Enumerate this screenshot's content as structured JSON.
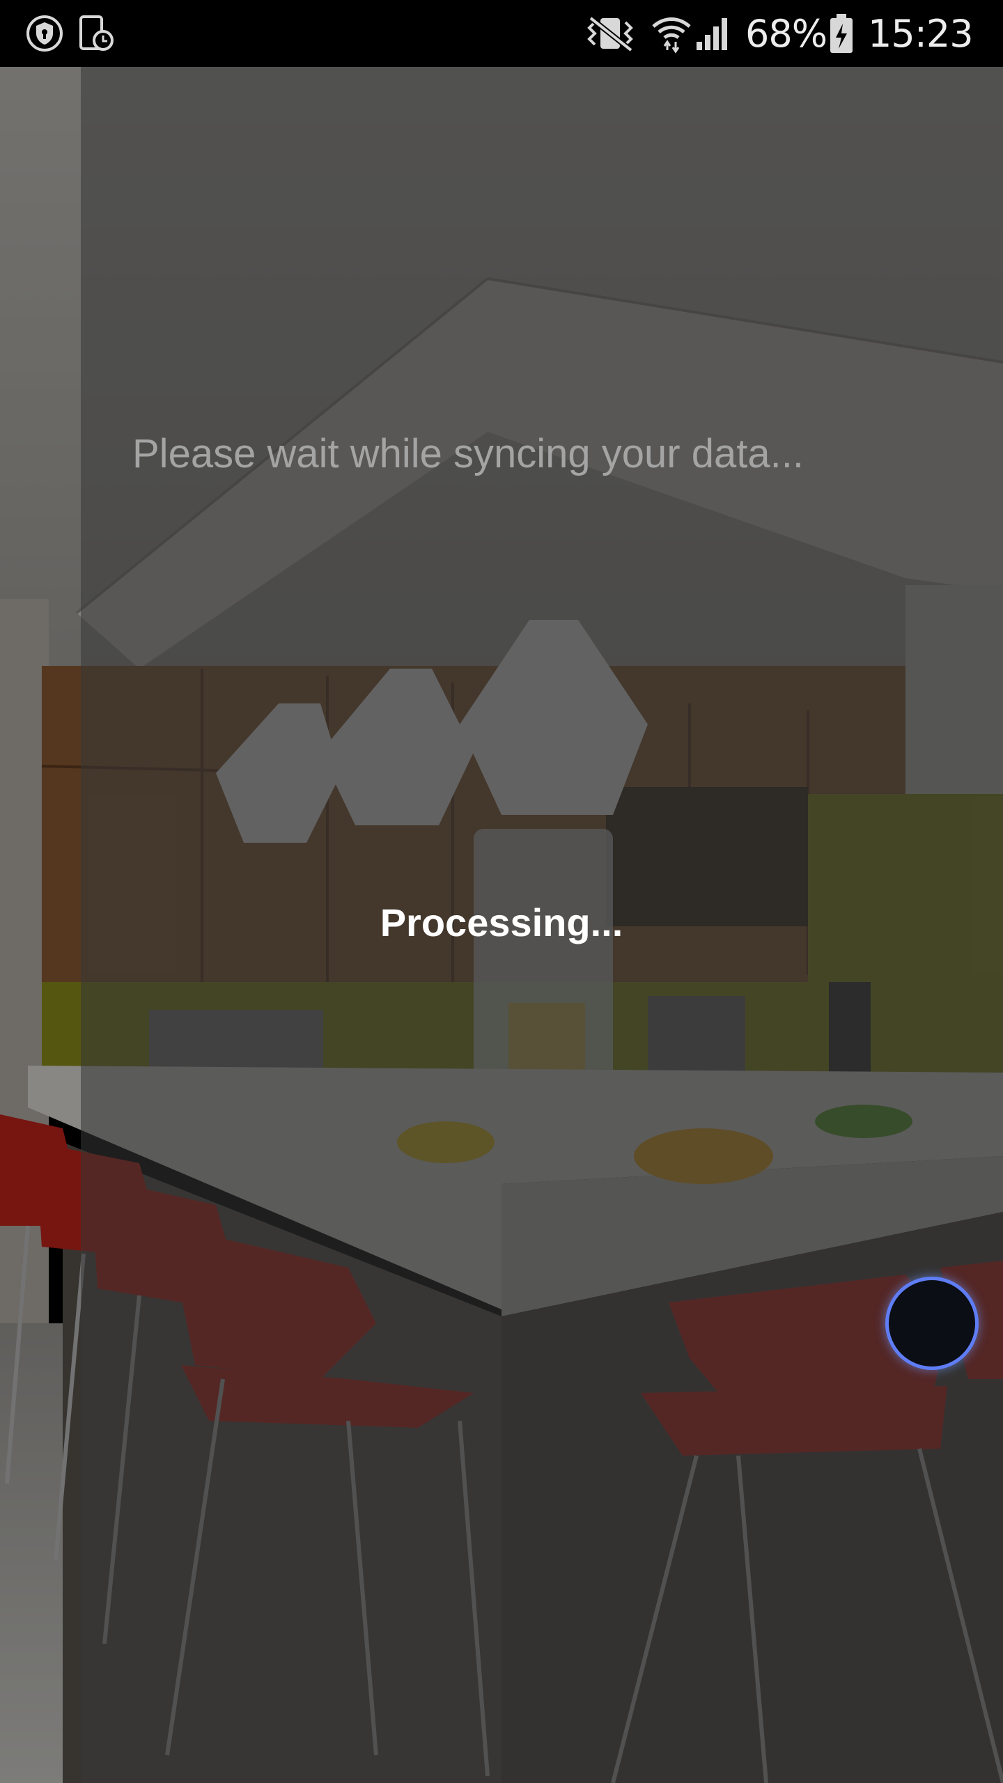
{
  "status_bar": {
    "battery_percent": "68%",
    "time": "15:23",
    "icons": [
      "shield-icon",
      "device-timer-icon",
      "vibrate-icon",
      "wifi-icon",
      "cell-signal-icon",
      "battery-charging-icon"
    ]
  },
  "overlay": {
    "sync_message": "Please wait while syncing your data...",
    "processing_label": "Processing..."
  },
  "floating_button": {
    "color": "#0b0e14",
    "ring_color": "#5f7df5"
  }
}
